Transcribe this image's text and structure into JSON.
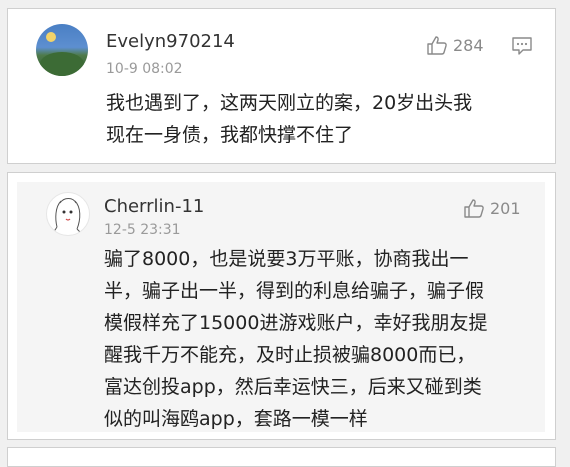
{
  "comments": [
    {
      "username": "Evelyn970214",
      "time": "10-9 08:02",
      "likes": "284",
      "content_lines": [
        "我也遇到了，这两天刚立的案，20岁出头我",
        "现在一身债，我都快撑不住了"
      ]
    },
    {
      "username": "Cherrlin-11",
      "time": "12-5 23:31",
      "likes": "201",
      "content_lines": [
        "骗了8000，也是说要3万平账，协商我出一",
        "半，骗子出一半，得到的利息给骗子，骗子假",
        "模假样充了15000进游戏账户，幸好我朋友提",
        "醒我千万不能充，及时止损被骗8000而已，",
        "富达创投app，然后幸运快三，后来又碰到类",
        "似的叫海鸥app，套路一模一样"
      ]
    }
  ],
  "icons": {
    "like": "thumbs-up-icon",
    "comment": "comment-icon"
  },
  "colors": {
    "text": "#222222",
    "meta": "#9a9a9a",
    "card_border": "#cfcfcf",
    "quoted_bg": "#f5f5f5"
  }
}
